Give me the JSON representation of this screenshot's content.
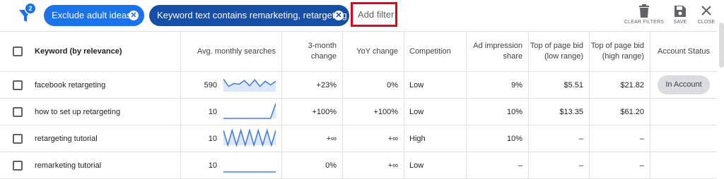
{
  "filters": {
    "count_badge": "2",
    "chips": [
      {
        "label": "Exclude adult ideas"
      },
      {
        "label": "Keyword text contains remarketing, retargeting"
      }
    ],
    "add_filter_label": "Add filter"
  },
  "toolbar": {
    "clear_filters": "CLEAR FILTERS",
    "save": "SAVE",
    "close": "CLOSE"
  },
  "table": {
    "headers": {
      "keyword": "Keyword (by relevance)",
      "avg_searches": "Avg. monthly searches",
      "three_month_change": "3-month change",
      "yoy_change": "YoY change",
      "competition": "Competition",
      "ad_impression_share": "Ad impression share",
      "top_bid_low": "Top of page bid (low range)",
      "top_bid_high": "Top of page bid (high range)",
      "account_status": "Account Status"
    },
    "rows": [
      {
        "keyword": "facebook retargeting",
        "avg_searches": "590",
        "three_month": "+23%",
        "yoy": "0%",
        "competition": "Low",
        "impression_share": "9%",
        "bid_low": "$5.51",
        "bid_high": "$21.82",
        "status": "In Account",
        "trend": [
          0.85,
          0.35,
          0.55,
          0.5,
          0.75,
          0.4,
          0.8,
          0.35,
          0.7,
          0.45,
          0.7
        ]
      },
      {
        "keyword": "how to set up retargeting",
        "avg_searches": "10",
        "three_month": "+100%",
        "yoy": "+100%",
        "competition": "Low",
        "impression_share": "10%",
        "bid_low": "$13.35",
        "bid_high": "$61.20",
        "status": "",
        "trend": [
          0,
          0,
          0,
          0,
          0,
          0,
          0,
          0,
          0,
          0,
          1
        ]
      },
      {
        "keyword": "retargeting tutorial",
        "avg_searches": "10",
        "three_month": "+∞",
        "yoy": "+∞",
        "competition": "High",
        "impression_share": "10%",
        "bid_low": "–",
        "bid_high": "–",
        "status": "",
        "trend": [
          1,
          0,
          1,
          0,
          1,
          0,
          1,
          0,
          1,
          0,
          1,
          0,
          1
        ]
      },
      {
        "keyword": "remarketing tutorial",
        "avg_searches": "10",
        "three_month": "0%",
        "yoy": "+∞",
        "competition": "Low",
        "impression_share": "–",
        "bid_low": "–",
        "bid_high": "–",
        "status": "",
        "trend": [
          0,
          0,
          0,
          0,
          0,
          0,
          0,
          0,
          0,
          0,
          0
        ]
      }
    ]
  },
  "colors": {
    "chip_light": "#1a73e8",
    "chip_dark": "#174ea6",
    "highlight_border": "#e3001b",
    "sparkline": "#4a7fd4",
    "sparkline_fill": "#dbe8fb"
  }
}
